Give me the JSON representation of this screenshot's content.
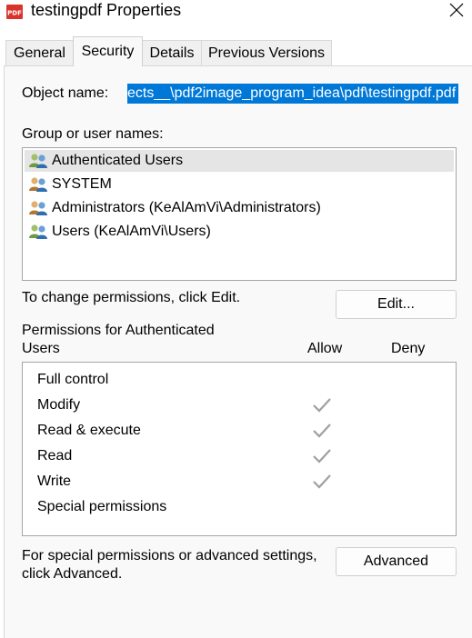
{
  "window": {
    "title": "testingpdf Properties",
    "icon": "pdf-file-icon",
    "icon_text": "PDF"
  },
  "tabs": [
    {
      "label": "General",
      "active": false
    },
    {
      "label": "Security",
      "active": true
    },
    {
      "label": "Details",
      "active": false
    },
    {
      "label": "Previous Versions",
      "active": false
    }
  ],
  "security": {
    "object_name_label": "Object name:",
    "object_name_value": "ects__\\pdf2image_program_idea\\pdf\\testingpdf.pdf",
    "group_label": "Group or user names:",
    "groups": [
      {
        "name": "Authenticated Users",
        "icon": "users-icon",
        "selected": true
      },
      {
        "name": "SYSTEM",
        "icon": "users-icon",
        "selected": false
      },
      {
        "name": "Administrators (KeAlAmVi\\Administrators)",
        "icon": "users-icon",
        "selected": false
      },
      {
        "name": "Users (KeAlAmVi\\Users)",
        "icon": "users-icon",
        "selected": false
      }
    ],
    "change_hint": "To change permissions, click Edit.",
    "edit_button": "Edit...",
    "permissions_for_line1": "Permissions for Authenticated",
    "permissions_for_line2": "Users",
    "allow_header": "Allow",
    "deny_header": "Deny",
    "permissions": [
      {
        "name": "Full control",
        "allow": false,
        "deny": false
      },
      {
        "name": "Modify",
        "allow": true,
        "deny": false
      },
      {
        "name": "Read & execute",
        "allow": true,
        "deny": false
      },
      {
        "name": "Read",
        "allow": true,
        "deny": false
      },
      {
        "name": "Write",
        "allow": true,
        "deny": false
      },
      {
        "name": "Special permissions",
        "allow": false,
        "deny": false
      }
    ],
    "advanced_hint_line1": "For special permissions or advanced settings,",
    "advanced_hint_line2": "click Advanced.",
    "advanced_button": "Advanced"
  },
  "colors": {
    "selection_highlight": "#0078d7",
    "checkmark_disabled": "#a0a0a0",
    "pdf_icon_red": "#d9342b"
  }
}
